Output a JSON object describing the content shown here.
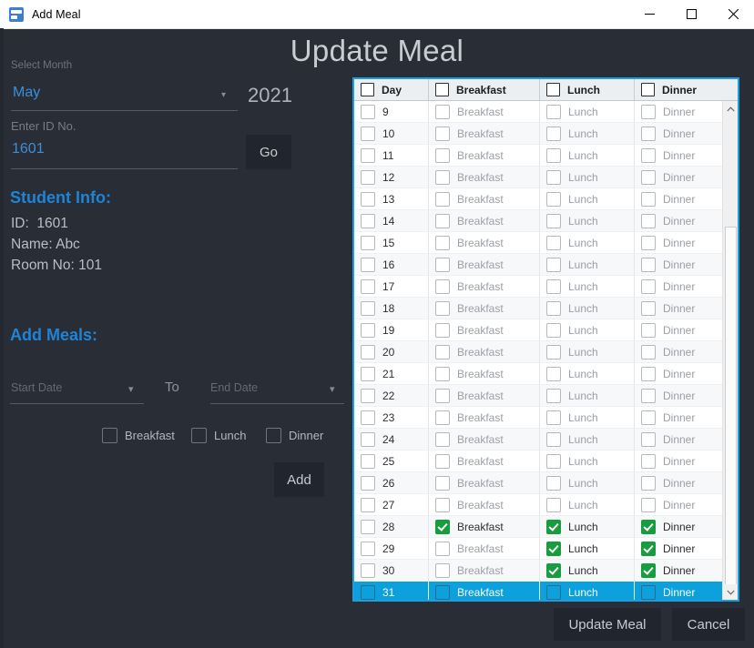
{
  "window": {
    "title": "Add Meal",
    "icon": "app-icon",
    "controls": {
      "minimize": "minimize-icon",
      "maximize": "maximize-icon",
      "close": "close-icon"
    }
  },
  "page": {
    "heading": "Update Meal"
  },
  "form": {
    "month_label": "Select Month",
    "month_value": "May",
    "month_caret": "chevron-down-icon",
    "year": "2021",
    "id_label": "Enter ID No.",
    "id_value": "1601",
    "go_label": "Go"
  },
  "student_info": {
    "heading": "Student Info:",
    "id_line": "ID:  1601",
    "name_line": "Name: Abc",
    "room_line": "Room No: 101"
  },
  "add_meals": {
    "heading": "Add Meals:",
    "start_date_placeholder": "Start Date",
    "to_label": "To",
    "end_date_placeholder": "End Date",
    "checkboxes": [
      {
        "label": "Breakfast",
        "checked": false
      },
      {
        "label": "Lunch",
        "checked": false
      },
      {
        "label": "Dinner",
        "checked": false
      }
    ],
    "add_label": "Add"
  },
  "grid": {
    "columns": [
      {
        "label": "Day",
        "header_checkbox": true
      },
      {
        "label": "Breakfast",
        "header_checkbox": true
      },
      {
        "label": "Lunch",
        "header_checkbox": true
      },
      {
        "label": "Dinner",
        "header_checkbox": true
      }
    ],
    "scrollbar": {
      "up_icon": "chevron-up-icon",
      "down_icon": "chevron-down-icon"
    },
    "rows": [
      {
        "day": "9",
        "breakfast": {
          "label": "Breakfast",
          "checked": false
        },
        "lunch": {
          "label": "Lunch",
          "checked": false
        },
        "dinner": {
          "label": "Dinner",
          "checked": false
        },
        "selected": false
      },
      {
        "day": "10",
        "breakfast": {
          "label": "Breakfast",
          "checked": false
        },
        "lunch": {
          "label": "Lunch",
          "checked": false
        },
        "dinner": {
          "label": "Dinner",
          "checked": false
        },
        "selected": false
      },
      {
        "day": "11",
        "breakfast": {
          "label": "Breakfast",
          "checked": false
        },
        "lunch": {
          "label": "Lunch",
          "checked": false
        },
        "dinner": {
          "label": "Dinner",
          "checked": false
        },
        "selected": false
      },
      {
        "day": "12",
        "breakfast": {
          "label": "Breakfast",
          "checked": false
        },
        "lunch": {
          "label": "Lunch",
          "checked": false
        },
        "dinner": {
          "label": "Dinner",
          "checked": false
        },
        "selected": false
      },
      {
        "day": "13",
        "breakfast": {
          "label": "Breakfast",
          "checked": false
        },
        "lunch": {
          "label": "Lunch",
          "checked": false
        },
        "dinner": {
          "label": "Dinner",
          "checked": false
        },
        "selected": false
      },
      {
        "day": "14",
        "breakfast": {
          "label": "Breakfast",
          "checked": false
        },
        "lunch": {
          "label": "Lunch",
          "checked": false
        },
        "dinner": {
          "label": "Dinner",
          "checked": false
        },
        "selected": false
      },
      {
        "day": "15",
        "breakfast": {
          "label": "Breakfast",
          "checked": false
        },
        "lunch": {
          "label": "Lunch",
          "checked": false
        },
        "dinner": {
          "label": "Dinner",
          "checked": false
        },
        "selected": false
      },
      {
        "day": "16",
        "breakfast": {
          "label": "Breakfast",
          "checked": false
        },
        "lunch": {
          "label": "Lunch",
          "checked": false
        },
        "dinner": {
          "label": "Dinner",
          "checked": false
        },
        "selected": false
      },
      {
        "day": "17",
        "breakfast": {
          "label": "Breakfast",
          "checked": false
        },
        "lunch": {
          "label": "Lunch",
          "checked": false
        },
        "dinner": {
          "label": "Dinner",
          "checked": false
        },
        "selected": false
      },
      {
        "day": "18",
        "breakfast": {
          "label": "Breakfast",
          "checked": false
        },
        "lunch": {
          "label": "Lunch",
          "checked": false
        },
        "dinner": {
          "label": "Dinner",
          "checked": false
        },
        "selected": false
      },
      {
        "day": "19",
        "breakfast": {
          "label": "Breakfast",
          "checked": false
        },
        "lunch": {
          "label": "Lunch",
          "checked": false
        },
        "dinner": {
          "label": "Dinner",
          "checked": false
        },
        "selected": false
      },
      {
        "day": "20",
        "breakfast": {
          "label": "Breakfast",
          "checked": false
        },
        "lunch": {
          "label": "Lunch",
          "checked": false
        },
        "dinner": {
          "label": "Dinner",
          "checked": false
        },
        "selected": false
      },
      {
        "day": "21",
        "breakfast": {
          "label": "Breakfast",
          "checked": false
        },
        "lunch": {
          "label": "Lunch",
          "checked": false
        },
        "dinner": {
          "label": "Dinner",
          "checked": false
        },
        "selected": false
      },
      {
        "day": "22",
        "breakfast": {
          "label": "Breakfast",
          "checked": false
        },
        "lunch": {
          "label": "Lunch",
          "checked": false
        },
        "dinner": {
          "label": "Dinner",
          "checked": false
        },
        "selected": false
      },
      {
        "day": "23",
        "breakfast": {
          "label": "Breakfast",
          "checked": false
        },
        "lunch": {
          "label": "Lunch",
          "checked": false
        },
        "dinner": {
          "label": "Dinner",
          "checked": false
        },
        "selected": false
      },
      {
        "day": "24",
        "breakfast": {
          "label": "Breakfast",
          "checked": false
        },
        "lunch": {
          "label": "Lunch",
          "checked": false
        },
        "dinner": {
          "label": "Dinner",
          "checked": false
        },
        "selected": false
      },
      {
        "day": "25",
        "breakfast": {
          "label": "Breakfast",
          "checked": false
        },
        "lunch": {
          "label": "Lunch",
          "checked": false
        },
        "dinner": {
          "label": "Dinner",
          "checked": false
        },
        "selected": false
      },
      {
        "day": "26",
        "breakfast": {
          "label": "Breakfast",
          "checked": false
        },
        "lunch": {
          "label": "Lunch",
          "checked": false
        },
        "dinner": {
          "label": "Dinner",
          "checked": false
        },
        "selected": false
      },
      {
        "day": "27",
        "breakfast": {
          "label": "Breakfast",
          "checked": false
        },
        "lunch": {
          "label": "Lunch",
          "checked": false
        },
        "dinner": {
          "label": "Dinner",
          "checked": false
        },
        "selected": false
      },
      {
        "day": "28",
        "breakfast": {
          "label": "Breakfast",
          "checked": true
        },
        "lunch": {
          "label": "Lunch",
          "checked": true
        },
        "dinner": {
          "label": "Dinner",
          "checked": true
        },
        "selected": false
      },
      {
        "day": "29",
        "breakfast": {
          "label": "Breakfast",
          "checked": false
        },
        "lunch": {
          "label": "Lunch",
          "checked": true
        },
        "dinner": {
          "label": "Dinner",
          "checked": true
        },
        "selected": false
      },
      {
        "day": "30",
        "breakfast": {
          "label": "Breakfast",
          "checked": false
        },
        "lunch": {
          "label": "Lunch",
          "checked": true
        },
        "dinner": {
          "label": "Dinner",
          "checked": true
        },
        "selected": false
      },
      {
        "day": "31",
        "breakfast": {
          "label": "Breakfast",
          "checked": false
        },
        "lunch": {
          "label": "Lunch",
          "checked": false
        },
        "dinner": {
          "label": "Dinner",
          "checked": false
        },
        "selected": true
      }
    ]
  },
  "footer": {
    "update_label": "Update Meal",
    "cancel_label": "Cancel"
  },
  "colors": {
    "window_bg": "#282d36",
    "accent_blue": "#1f84d6",
    "selection_blue": "#0ca0dd",
    "checked_green": "#179c3e",
    "border_cyan": "#1e9de0"
  }
}
